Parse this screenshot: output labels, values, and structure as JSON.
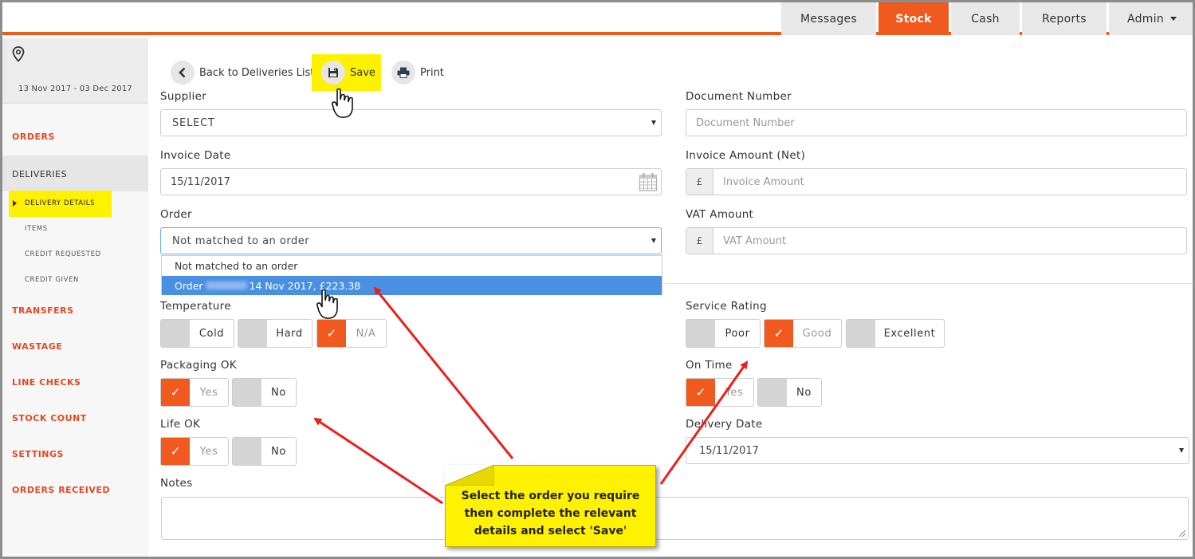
{
  "nav": {
    "tabs": [
      "Messages",
      "Stock",
      "Cash",
      "Reports",
      "Admin"
    ],
    "active": "Stock"
  },
  "sidebar": {
    "date_range": "13 Nov 2017 - 03 Dec 2017",
    "items": [
      "ORDERS",
      "DELIVERIES",
      "TRANSFERS",
      "WASTAGE",
      "LINE CHECKS",
      "STOCK COUNT",
      "SETTINGS",
      "ORDERS RECEIVED"
    ],
    "sub_items": [
      "DELIVERY DETAILS",
      "ITEMS",
      "CREDIT REQUESTED",
      "CREDIT GIVEN"
    ]
  },
  "toolbar": {
    "back_label": "Back to Deliveries List",
    "save_label": "Save",
    "print_label": "Print"
  },
  "form": {
    "supplier_label": "Supplier",
    "supplier_value": "SELECT",
    "document_number_label": "Document Number",
    "document_number_placeholder": "Document Number",
    "invoice_date_label": "Invoice Date",
    "invoice_date_value": "15/11/2017",
    "invoice_amount_label": "Invoice Amount (Net)",
    "invoice_amount_placeholder": "Invoice Amount",
    "currency": "£",
    "order_label": "Order",
    "order_value": "Not matched to an order",
    "order_options": [
      "Not matched to an order",
      "Order",
      "14 Nov 2017, £223.38"
    ],
    "vat_amount_label": "VAT Amount",
    "vat_amount_placeholder": "VAT Amount",
    "temperature_label": "Temperature",
    "temperature_options": [
      "Cold",
      "Hard",
      "N/A"
    ],
    "service_rating_label": "Service Rating",
    "service_rating_options": [
      "Poor",
      "Good",
      "Excellent"
    ],
    "packaging_label": "Packaging OK",
    "on_time_label": "On Time",
    "life_label": "Life OK",
    "yes": "Yes",
    "no": "No",
    "delivery_date_label": "Delivery Date",
    "delivery_date_value": "15/11/2017",
    "notes_label": "Notes"
  },
  "callout": {
    "lines": [
      "Select the order you require",
      "then complete the relevant",
      "details and select 'Save'"
    ]
  },
  "colors": {
    "accent": "#f05a1e",
    "highlight": "#fff200",
    "selected_option": "#4a90e2",
    "arrow": "#e8201c"
  }
}
